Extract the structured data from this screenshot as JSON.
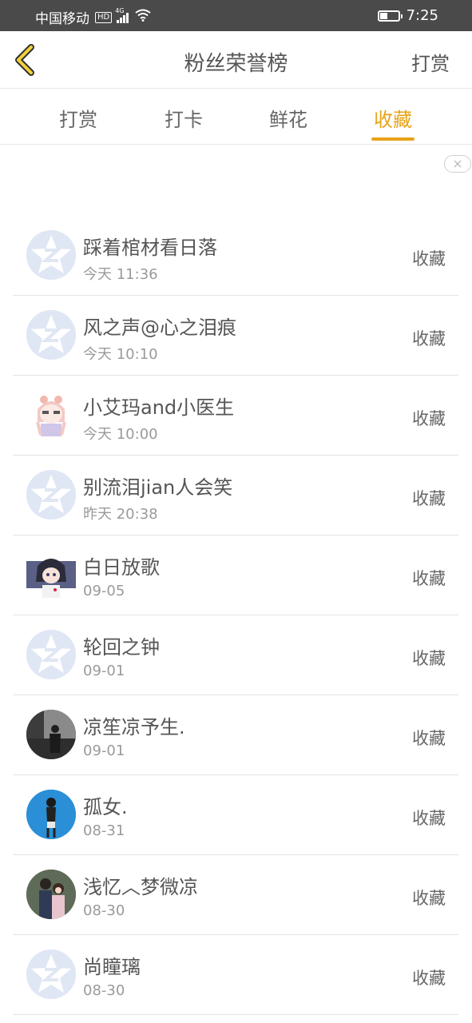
{
  "status_bar": {
    "carrier": "中国移动",
    "hd": "HD",
    "network": "4G",
    "time": "7:25"
  },
  "nav": {
    "title": "粉丝荣誉榜",
    "action": "打赏"
  },
  "tabs": [
    {
      "label": "打赏"
    },
    {
      "label": "打卡"
    },
    {
      "label": "鲜花"
    },
    {
      "label": "收藏"
    }
  ],
  "active_tab": "收藏",
  "accent_color": "#e8a317",
  "fans": [
    {
      "name": "踩着棺材看日落",
      "time": "今天 11:36",
      "badge": "收藏",
      "avatar": "default-star"
    },
    {
      "name": "风之声@心之泪痕",
      "time": "今天 10:10",
      "badge": "收藏",
      "avatar": "default-star"
    },
    {
      "name": "小艾玛and小医生",
      "time": "今天 10:00",
      "badge": "收藏",
      "avatar": "anime-girl"
    },
    {
      "name": "别流泪jian人会笑",
      "time": "昨天 20:38",
      "badge": "收藏",
      "avatar": "default-star"
    },
    {
      "name": "白日放歌",
      "time": "09-05",
      "badge": "收藏",
      "avatar": "anime-boy"
    },
    {
      "name": "轮回之钟",
      "time": "09-01",
      "badge": "收藏",
      "avatar": "default-star"
    },
    {
      "name": "凉笙凉予生.",
      "time": "09-01",
      "badge": "收藏",
      "avatar": "dark-photo"
    },
    {
      "name": "孤女.",
      "time": "08-31",
      "badge": "收藏",
      "avatar": "blue-photo"
    },
    {
      "name": "浅忆︿梦微凉",
      "time": "08-30",
      "badge": "收藏",
      "avatar": "couple-photo"
    },
    {
      "name": "尚瞳璃",
      "time": "08-30",
      "badge": "收藏",
      "avatar": "default-star"
    }
  ]
}
